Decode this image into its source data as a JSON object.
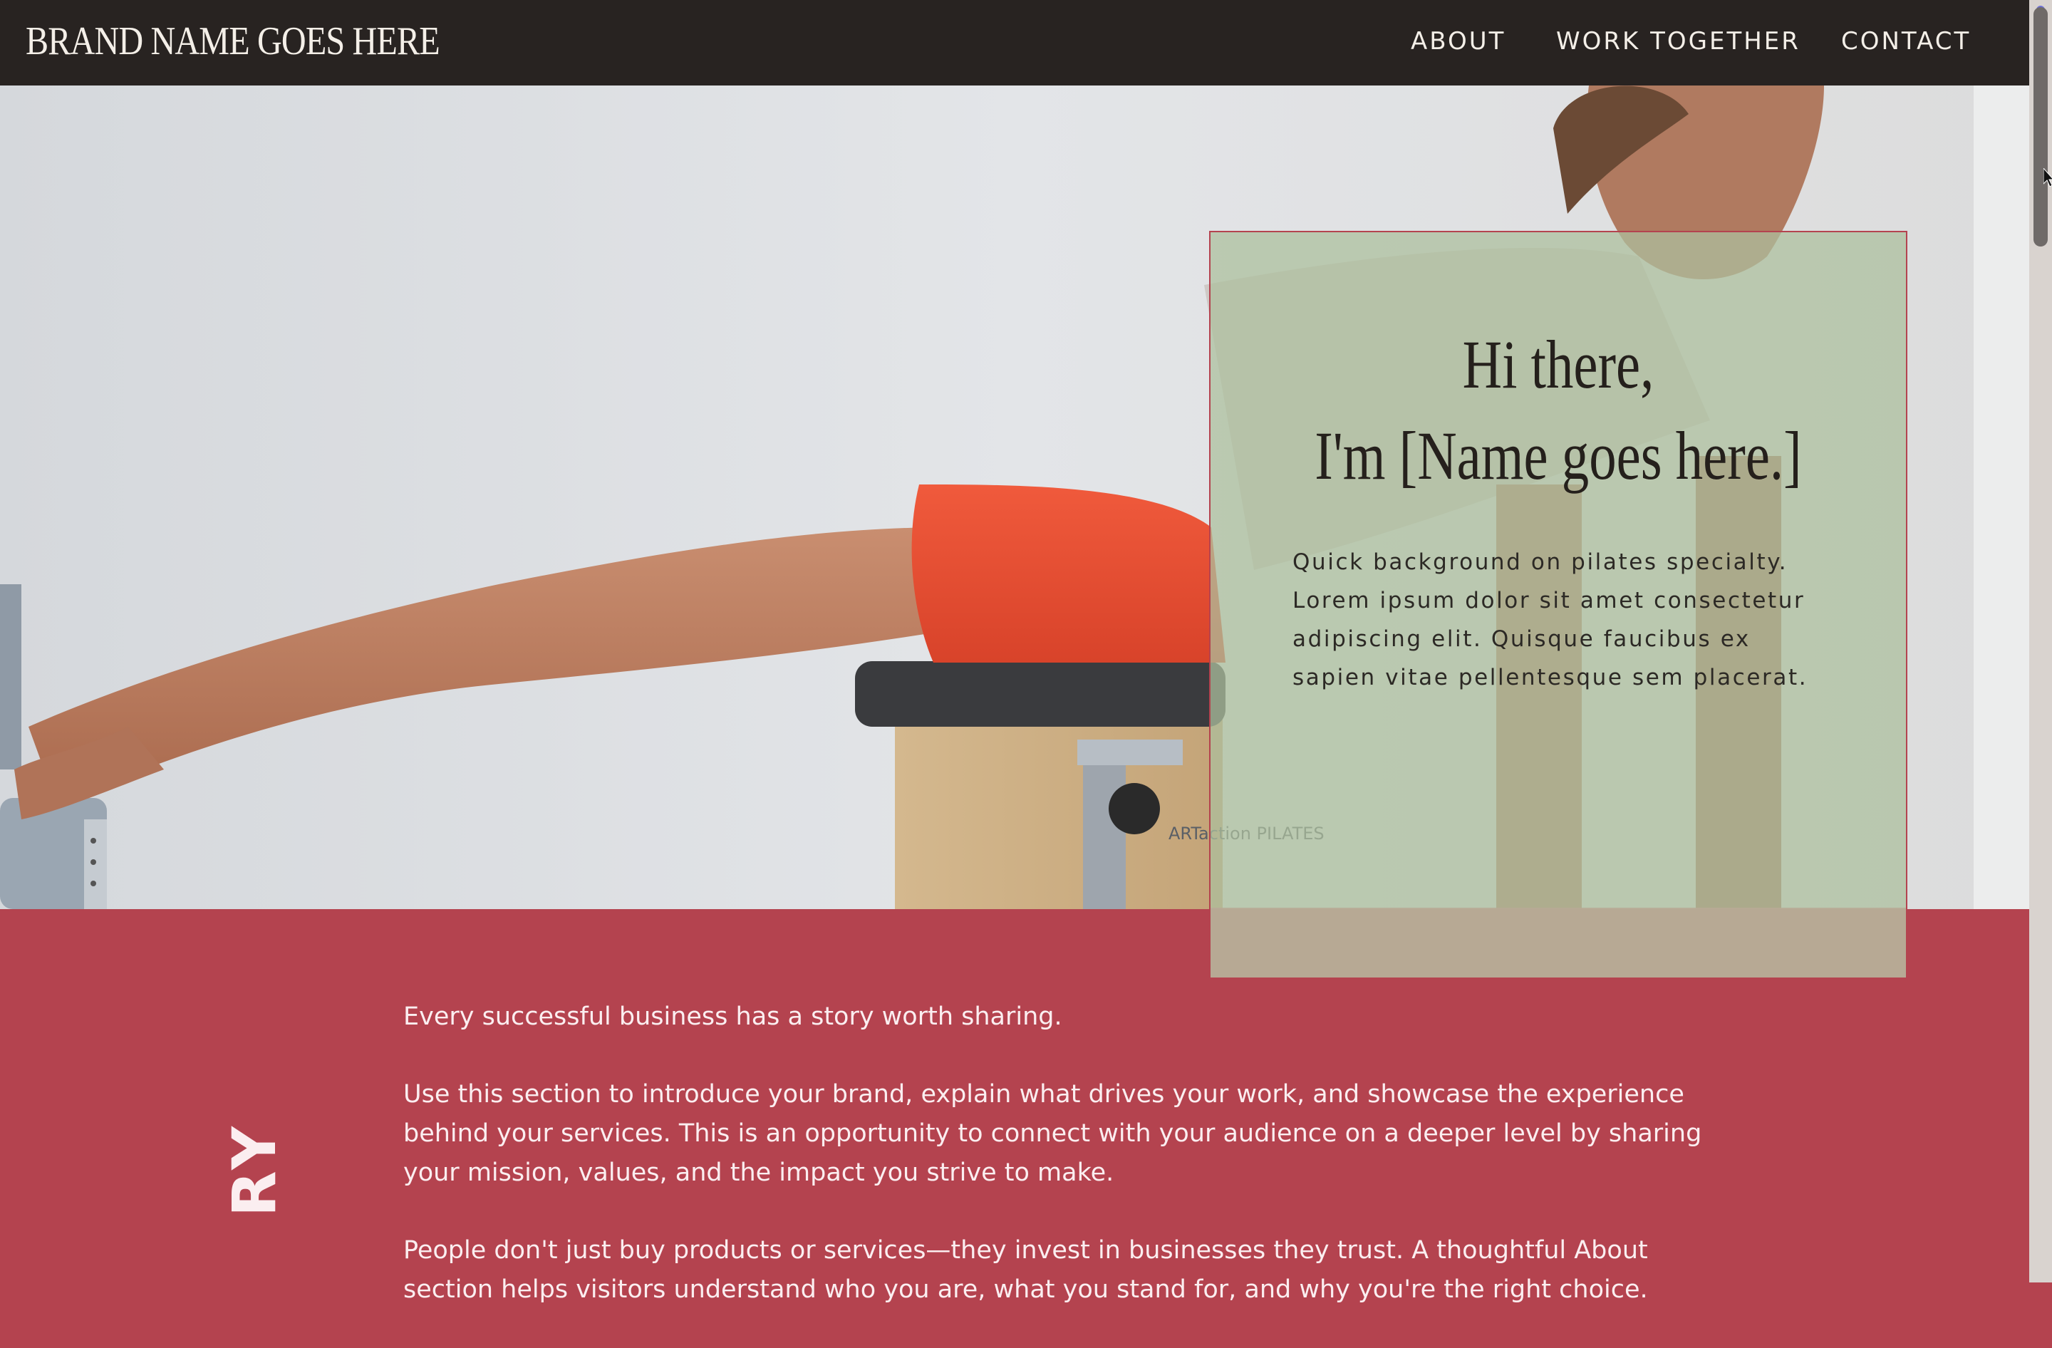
{
  "nav": {
    "brand": "BRAND NAME GOES HERE",
    "links": [
      "ABOUT",
      "WORK TOGETHER",
      "CONTACT"
    ]
  },
  "hero": {
    "photo_watermark": "ARTaction PILATES",
    "intro": {
      "heading_line1": "Hi there,",
      "heading_line2": "I'm [Name goes here.]",
      "body": "Quick background on pilates specialty. Lorem ipsum dolor sit amet consectetur adipiscing elit. Quisque faucibus ex sapien vitae pellentesque sem placerat."
    }
  },
  "story": {
    "side_label": "RY",
    "paragraphs": [
      "Every successful business has a story worth sharing.",
      "Use this section to introduce your brand, explain what drives your work, and showcase the experience behind your services. This is an opportunity to connect with your audience on a deeper level by sharing your mission, values, and the impact you strive to make.",
      "People don't just buy products or services—they invest in businesses they trust. A thoughtful About section helps visitors understand who you are, what you stand for, and why you're the right choice."
    ]
  },
  "colors": {
    "nav_bg": "#282321",
    "accent": "#b4434f",
    "card_tint": "#adbf9e",
    "text_light": "#f4efe8"
  },
  "icons": {
    "scroll_position": "scroll-position-dot-icon",
    "cursor": "mouse-pointer-icon"
  }
}
